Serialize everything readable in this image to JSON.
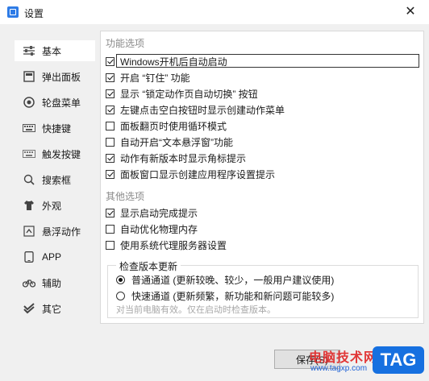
{
  "window": {
    "title": "设置",
    "close_glyph": "✕"
  },
  "sidebar": {
    "items": [
      {
        "label": "基本",
        "icon": "sliders-icon",
        "active": true
      },
      {
        "label": "弹出面板",
        "icon": "popup-panel-icon",
        "active": false
      },
      {
        "label": "轮盘菜单",
        "icon": "wheel-menu-icon",
        "active": false
      },
      {
        "label": "快捷键",
        "icon": "keyboard-icon",
        "active": false
      },
      {
        "label": "触发按键",
        "icon": "trigger-key-icon",
        "active": false
      },
      {
        "label": "搜索框",
        "icon": "search-icon",
        "active": false
      },
      {
        "label": "外观",
        "icon": "shirt-icon",
        "active": false
      },
      {
        "label": "悬浮动作",
        "icon": "float-action-icon",
        "active": false
      },
      {
        "label": "APP",
        "icon": "app-icon",
        "active": false
      },
      {
        "label": "辅助",
        "icon": "bike-icon",
        "active": false
      },
      {
        "label": "其它",
        "icon": "check-badge-icon",
        "active": false
      }
    ]
  },
  "features": {
    "title": "功能选项",
    "options": [
      {
        "label": "Windows开机后自动启动",
        "checked": true
      },
      {
        "label": "开启 “钉住” 功能",
        "checked": true
      },
      {
        "label": "显示 “锁定动作页自动切换” 按钮",
        "checked": true
      },
      {
        "label": "左键点击空白按钮时显示创建动作菜单",
        "checked": true
      },
      {
        "label": "面板翻页时使用循环模式",
        "checked": false
      },
      {
        "label": "自动开启“文本悬浮窗”功能",
        "checked": false
      },
      {
        "label": "动作有新版本时显示角标提示",
        "checked": true
      },
      {
        "label": "面板窗口显示创建应用程序设置提示",
        "checked": true
      }
    ]
  },
  "other": {
    "title": "其他选项",
    "options": [
      {
        "label": "显示启动完成提示",
        "checked": true
      },
      {
        "label": "自动优化物理内存",
        "checked": false
      },
      {
        "label": "使用系统代理服务器设置",
        "checked": false
      }
    ]
  },
  "update": {
    "title": "检查版本更新",
    "channels": [
      {
        "label": "普通通道 (更新较晚、较少，一般用户建议使用)",
        "selected": true
      },
      {
        "label": "快速通道 (更新频繁，新功能和新问题可能较多)",
        "selected": false
      }
    ],
    "note": "对当前电脑有效。仅在启动时检查版本。"
  },
  "footer": {
    "save_label": "保存(S)"
  },
  "watermark": {
    "site": "电脑技术网",
    "url": "www.tagxp.com",
    "tag": "TAG"
  }
}
